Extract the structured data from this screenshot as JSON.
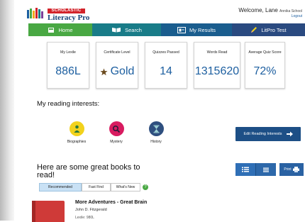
{
  "colors": {
    "home_tab": "#49a843",
    "search_tab": "#197c88",
    "results_tab": "#1a5d8e",
    "test_tab": "#2a4a80",
    "primary_button": "#1d4f86",
    "value_blue": "#1d5fa0",
    "brand_red": "#d2232a"
  },
  "header": {
    "brand_badge": "SCHOLASTIC",
    "brand_name": "Literacy Pro",
    "welcome": "Welcome, Lane",
    "school": "Annika School",
    "logout": "Logout"
  },
  "nav": {
    "home": "Home",
    "search": "Search",
    "results": "My Results",
    "test": "LitPro Test"
  },
  "stats": [
    {
      "label": "My Lexile",
      "value": "886L"
    },
    {
      "label": "Certificate Level",
      "value": "Gold",
      "icon": "star-icon"
    },
    {
      "label": "Quizzes Passed",
      "value": "14"
    },
    {
      "label": "Words Read",
      "value": "1315620"
    },
    {
      "label": "Average Quiz Score",
      "value": "72%"
    }
  ],
  "interests": {
    "title": "My reading interests:",
    "items": [
      {
        "label": "Biographies",
        "icon": "person-icon",
        "color": "#f2d21c"
      },
      {
        "label": "Mystery",
        "icon": "magnifier-icon",
        "color": "#d81b60"
      },
      {
        "label": "History",
        "icon": "hourglass-icon",
        "color": "#2f4f7f"
      }
    ],
    "edit_button": "Edit Reading Interests"
  },
  "books": {
    "title": "Here are some great books to read!",
    "print_label": "Print",
    "tabs": [
      "Recommended",
      "Fast Find",
      "What's New"
    ],
    "active_tab": "Recommended",
    "help": "?",
    "first_book": {
      "title": "More Adventures - Great Brain",
      "author": "John D. Fitzgerald",
      "lexile": "Lexile: 980L"
    }
  }
}
